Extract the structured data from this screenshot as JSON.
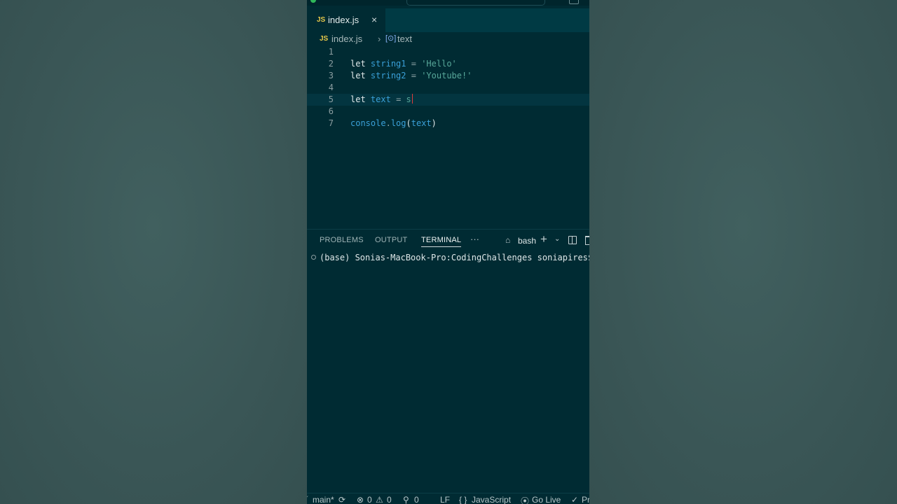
{
  "tab": {
    "lang_badge": "JS",
    "filename": "index.js",
    "close": "×"
  },
  "breadcrumb": {
    "lang_badge": "JS",
    "file": "index.js",
    "separator": "›",
    "symbol_icon": "[⊙]",
    "symbol": "text"
  },
  "code": {
    "line_numbers": [
      "1",
      "2",
      "3",
      "4",
      "5",
      "6",
      "7"
    ],
    "l2": {
      "kw": "let",
      "var": "string1",
      "op": "=",
      "str": "'Hello'"
    },
    "l3": {
      "kw": "let",
      "var": "string2",
      "op": "=",
      "str": "'Youtube!'"
    },
    "l5": {
      "kw": "let",
      "var": "text",
      "op": "=",
      "typed": "s"
    },
    "l7": {
      "obj": "console",
      "dot": ".",
      "fn": "log",
      "open": "(",
      "arg": "text",
      "close": ")"
    }
  },
  "panel": {
    "tabs": [
      "PROBLEMS",
      "OUTPUT",
      "TERMINAL"
    ],
    "active_tab": "TERMINAL",
    "more": "···",
    "shell": "bash",
    "add": "+",
    "chevron": "⌄"
  },
  "terminal": {
    "prompt": "(base) Sonias-MacBook-Pro:CodingChallenges soniapires$"
  },
  "statusbar": {
    "branch": "main*",
    "errors": "0",
    "warnings": "0",
    "ports": "0",
    "eol": "LF",
    "language": "JavaScript",
    "go_live": "Go Live",
    "cut": "Pr"
  },
  "colors": {
    "editor_bg": "#002b33",
    "keyword": "#dfe7e8",
    "variable": "#3aa0d8",
    "string": "#58a89a",
    "js_badge": "#e8c94a"
  }
}
